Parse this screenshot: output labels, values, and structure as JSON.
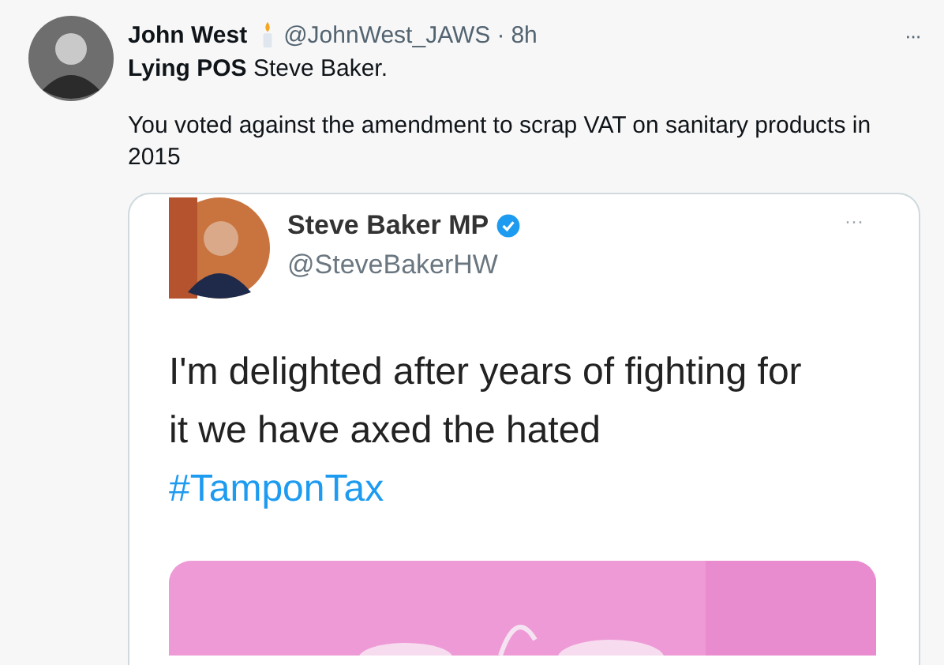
{
  "tweet": {
    "name": "John West",
    "handle": "@JohnWest_JAWS",
    "separator": "·",
    "time": "8h",
    "more": "···",
    "paragraphs": [
      "**Lying POS** Steve Baker.",
      "You voted against the amendment to scrap VAT on sanitary products in 2015"
    ],
    "quoted": {
      "name": "Steve Baker MP",
      "verified": true,
      "handle": "@SteveBakerHW",
      "more": "···",
      "lines": [
        "I'm delighted after years of fighting for",
        "it we have axed the hated"
      ],
      "hashtag": "#TamponTax"
    }
  }
}
